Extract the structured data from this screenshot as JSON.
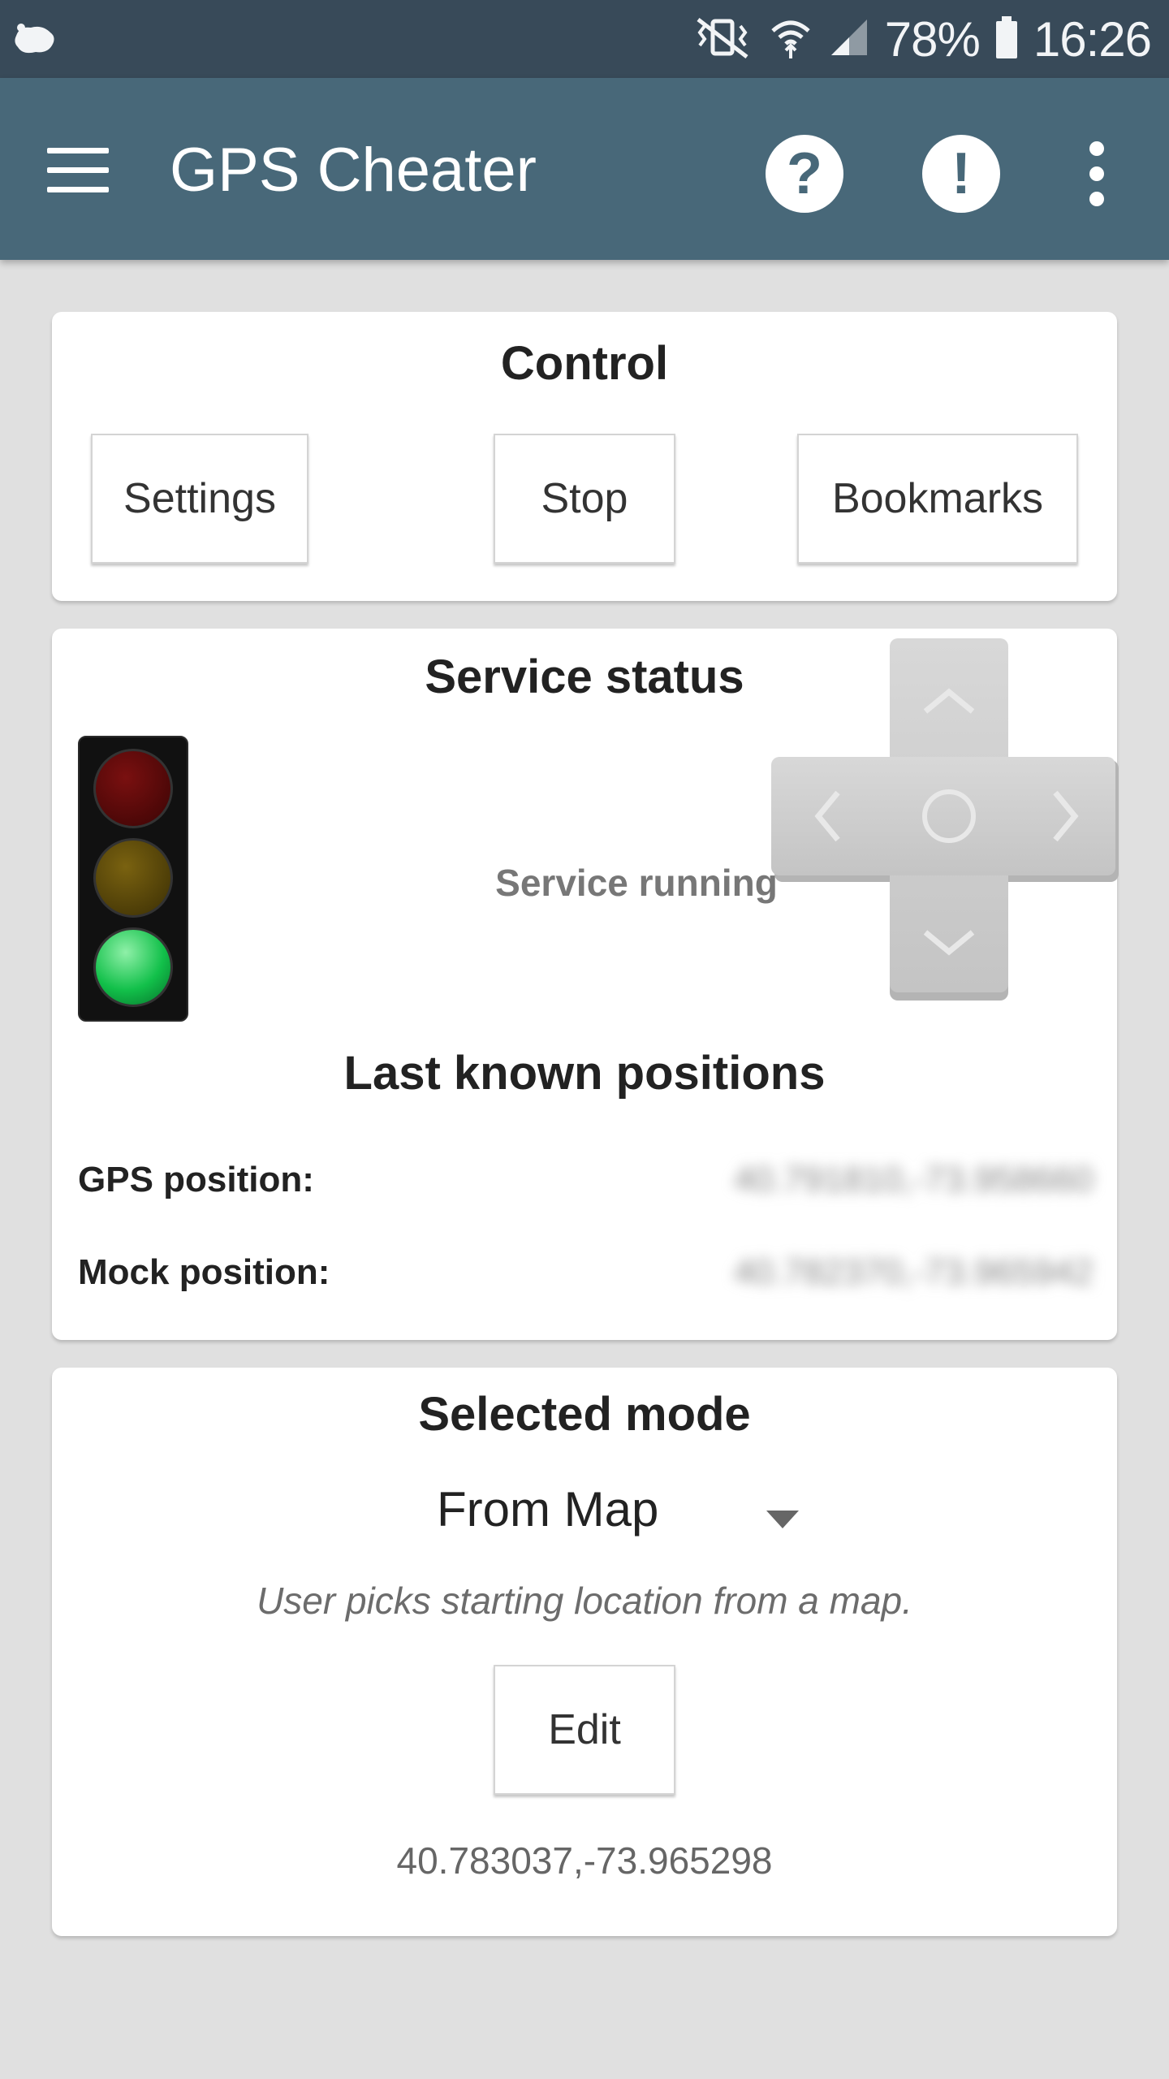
{
  "status_bar": {
    "battery": "78%",
    "time": "16:26",
    "icons": [
      "app-notification-icon",
      "vibrate-icon",
      "wifi-icon",
      "signal-icon",
      "battery-icon"
    ]
  },
  "app_bar": {
    "title": "GPS Cheater",
    "help_icon": "?",
    "alert_icon": "!"
  },
  "control": {
    "title": "Control",
    "settings_label": "Settings",
    "stop_label": "Stop",
    "bookmarks_label": "Bookmarks"
  },
  "service": {
    "title": "Service status",
    "status_text": "Service running",
    "positions_title": "Last known positions",
    "gps_label": "GPS position:",
    "gps_value": "40.791810,-73.958660",
    "mock_label": "Mock position:",
    "mock_value": "40.782370,-73.965942"
  },
  "mode": {
    "title": "Selected mode",
    "selected": "From Map",
    "description": "User picks starting location from a map.",
    "edit_label": "Edit",
    "coordinates": "40.783037,-73.965298"
  },
  "colors": {
    "status_bar": "#384a59",
    "app_bar": "#486879",
    "background": "#e0e0e0",
    "card": "#ffffff"
  }
}
